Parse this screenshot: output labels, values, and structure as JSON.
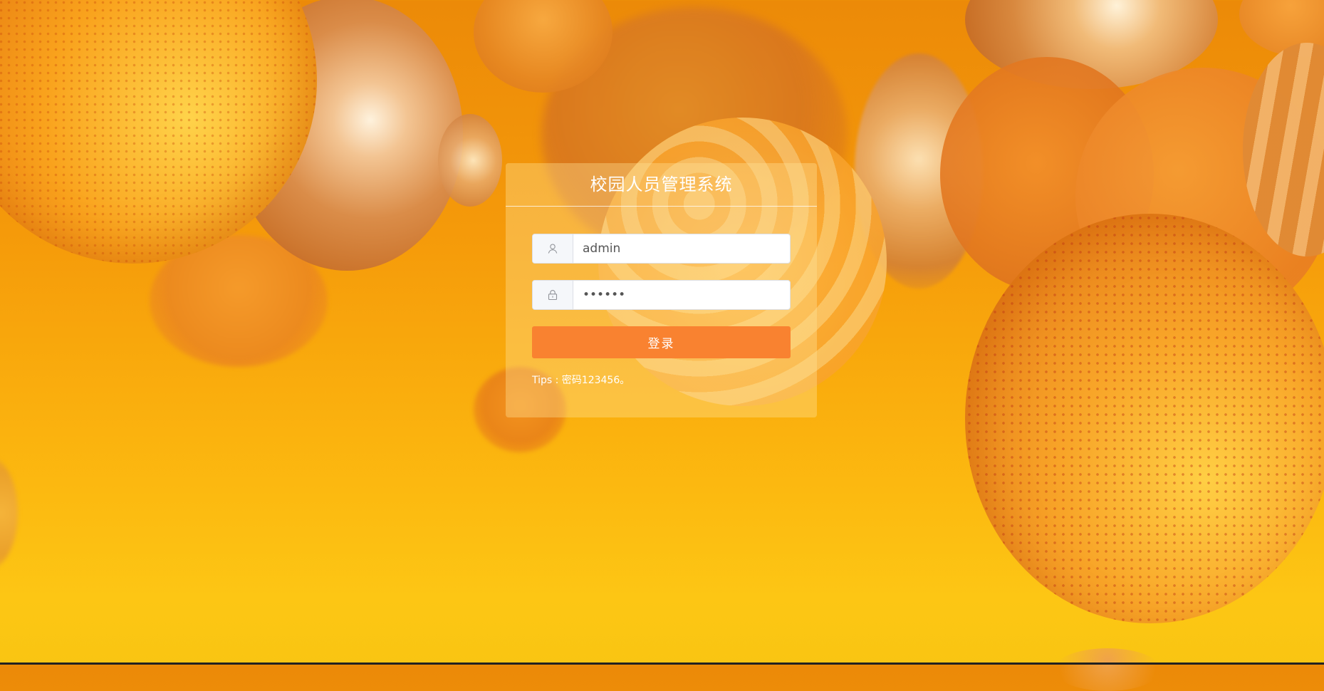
{
  "login": {
    "title": "校园人员管理系统",
    "username": {
      "value": "admin",
      "placeholder": "",
      "icon": "user-icon"
    },
    "password": {
      "value": "••••••",
      "placeholder": "",
      "icon": "lock-icon"
    },
    "submit_label": "登录",
    "tips": "Tips : 密码123456。"
  },
  "colors": {
    "button": "#f98230",
    "panel": "rgba(255,225,150,.38)",
    "title": "#ffffff"
  }
}
